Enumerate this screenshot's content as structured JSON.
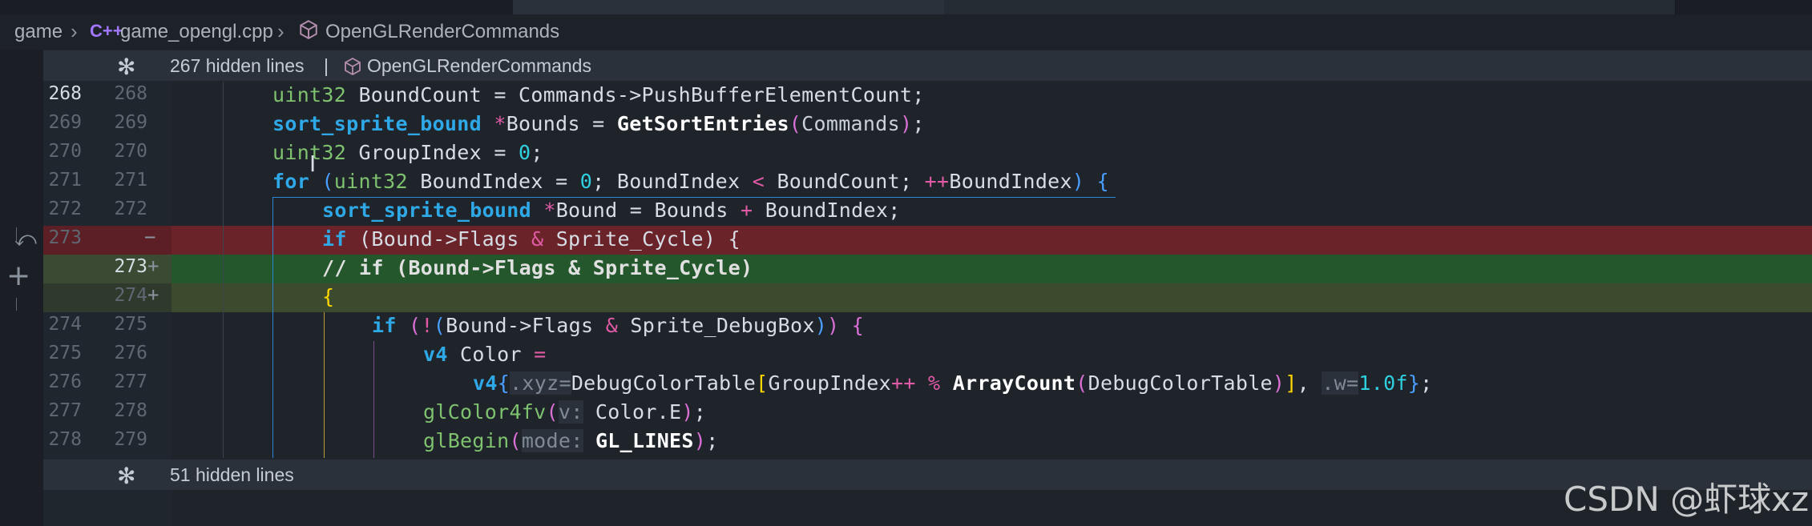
{
  "breadcrumb": {
    "folder": "game",
    "file": "game_opengl.cpp",
    "file_icon": "C++",
    "symbol": "OpenGLRenderCommands"
  },
  "fold_top": {
    "text": "267 hidden lines",
    "sep": "|",
    "symbol": "OpenGLRenderCommands"
  },
  "fold_bottom": {
    "text": "51 hidden lines"
  },
  "lines": [
    {
      "old": "268",
      "new": "268",
      "mark": ""
    },
    {
      "old": "269",
      "new": "269",
      "mark": ""
    },
    {
      "old": "270",
      "new": "270",
      "mark": ""
    },
    {
      "old": "271",
      "new": "271",
      "mark": ""
    },
    {
      "old": "272",
      "new": "272",
      "mark": ""
    },
    {
      "old": "273",
      "new": "",
      "mark": "−"
    },
    {
      "old": "",
      "new": "273",
      "mark": "+"
    },
    {
      "old": "",
      "new": "274",
      "mark": "+"
    },
    {
      "old": "274",
      "new": "275",
      "mark": ""
    },
    {
      "old": "275",
      "new": "276",
      "mark": ""
    },
    {
      "old": "276",
      "new": "277",
      "mark": ""
    },
    {
      "old": "277",
      "new": "278",
      "mark": ""
    },
    {
      "old": "278",
      "new": "279",
      "mark": ""
    }
  ],
  "code": {
    "l1": [
      "uint32",
      " BoundCount = Commands->PushBufferElementCount;"
    ],
    "l2": [
      "sort_sprite_bound",
      " ",
      "*",
      "Bounds = ",
      "GetSortEntries",
      "(",
      "Commands",
      ")",
      ";"
    ],
    "l3": [
      "uint32",
      " GroupIndex = ",
      "0",
      ";"
    ],
    "l4": [
      "for",
      " (",
      "uint32",
      " BoundIndex = ",
      "0",
      "; BoundIndex ",
      "<",
      " BoundCount; ",
      "++",
      "BoundIndex",
      ")",
      " {"
    ],
    "l5": [
      "sort_sprite_bound",
      " ",
      "*",
      "Bound = Bounds ",
      "+",
      " BoundIndex;"
    ],
    "l6": [
      "if",
      " (Bound->Flags ",
      "&",
      " Sprite_Cycle) {"
    ],
    "l7": [
      "// if (Bound->Flags & Sprite_Cycle)"
    ],
    "l8": [
      "{"
    ],
    "l9": [
      "if",
      " (",
      "!",
      "(",
      "Bound->Flags ",
      "&",
      " Sprite_DebugBox",
      ")",
      ")",
      " {"
    ],
    "l10": [
      "v4",
      " Color ",
      "="
    ],
    "l11": [
      "v4",
      "{",
      ".xyz=",
      "DebugColorTable",
      "[",
      "GroupIndex",
      "++",
      " % ",
      "ArrayCount",
      "(",
      "DebugColorTable",
      ")",
      "]",
      ", ",
      ".w=",
      "1.0f",
      "}",
      ";"
    ],
    "l12": [
      "glColor4fv",
      "(",
      "v:",
      " Color.E",
      ")",
      ";"
    ],
    "l13": [
      "glBegin",
      "(",
      "mode:",
      " ",
      "GL_LINES",
      ")",
      ";"
    ]
  },
  "watermark": "CSDN @虾球xz",
  "colors": {
    "background": "#1f242b",
    "deleted": "#6a2329",
    "added": "#24582c",
    "type": "#7ec16e",
    "keyword": "#2ea8e6",
    "number": "#2fd0e0",
    "operator": "#e05aa6"
  }
}
